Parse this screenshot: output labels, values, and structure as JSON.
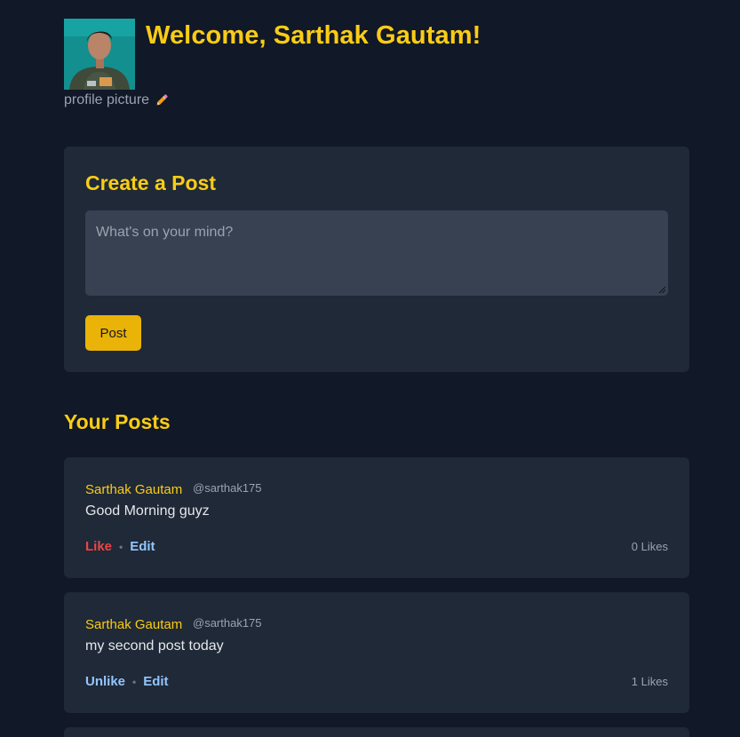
{
  "header": {
    "welcome": "Welcome, Sarthak Gautam!",
    "profile_caption": "profile picture",
    "edit_icon": "pencil-icon"
  },
  "create_post": {
    "title": "Create a Post",
    "placeholder": "What's on your mind?",
    "value": "",
    "submit_label": "Post"
  },
  "posts_section": {
    "title": "Your Posts",
    "posts": [
      {
        "author": "Sarthak Gautam",
        "handle": "@sarthak175",
        "content": "Good Morning guyz",
        "like_label": "Like",
        "edit_label": "Edit",
        "likes": "0 Likes"
      },
      {
        "author": "Sarthak Gautam",
        "handle": "@sarthak175",
        "content": "my second post today",
        "like_label": "Unlike",
        "edit_label": "Edit",
        "likes": "1 Likes"
      }
    ]
  },
  "colors": {
    "background": "#111827",
    "card": "#1f2937",
    "accent": "#facc15",
    "button": "#eab308",
    "like": "#ef4444",
    "link": "#93c5fd"
  }
}
